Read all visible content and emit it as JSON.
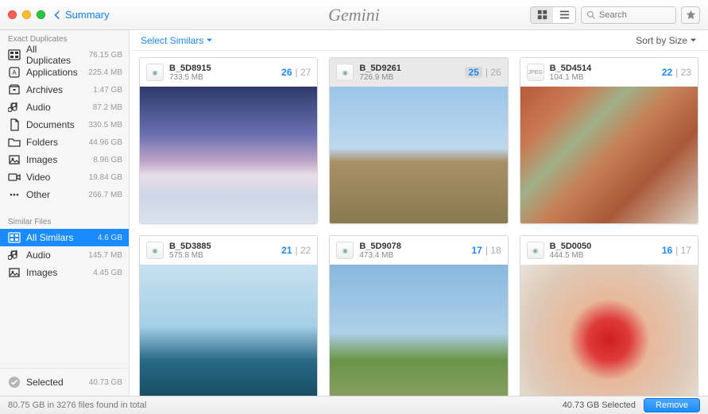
{
  "titlebar": {
    "back_label": "Summary",
    "app_name": "Gemini",
    "search_placeholder": "Search"
  },
  "sidebar": {
    "exact_header": "Exact Duplicates",
    "similar_header": "Similar Files",
    "exact": [
      {
        "icon": "all",
        "label": "All Duplicates",
        "size": "76.15 GB"
      },
      {
        "icon": "app",
        "label": "Applications",
        "size": "225.4 MB"
      },
      {
        "icon": "archive",
        "label": "Archives",
        "size": "1.47 GB"
      },
      {
        "icon": "audio",
        "label": "Audio",
        "size": "87.2 MB"
      },
      {
        "icon": "doc",
        "label": "Documents",
        "size": "330.5 MB"
      },
      {
        "icon": "folder",
        "label": "Folders",
        "size": "44.96 GB"
      },
      {
        "icon": "image",
        "label": "Images",
        "size": "8.96 GB"
      },
      {
        "icon": "video",
        "label": "Video",
        "size": "19.84 GB"
      },
      {
        "icon": "other",
        "label": "Other",
        "size": "266.7 MB"
      }
    ],
    "similar": [
      {
        "icon": "all",
        "label": "All Similars",
        "size": "4.6 GB",
        "active": true
      },
      {
        "icon": "audio",
        "label": "Audio",
        "size": "145.7 MB"
      },
      {
        "icon": "image",
        "label": "Images",
        "size": "4.45 GB"
      }
    ],
    "selected": {
      "label": "Selected",
      "size": "40.73 GB"
    }
  },
  "content_bar": {
    "select_similars": "Select Similars",
    "sort_by": "Sort by Size"
  },
  "cards": [
    {
      "name": "B_5D8915",
      "size": "733.5 MB",
      "sel": 26,
      "tot": 27,
      "type": "cr2",
      "active": false,
      "bg": "mountains"
    },
    {
      "name": "B_5D9261",
      "size": "726.9 MB",
      "sel": 25,
      "tot": 26,
      "type": "cr2",
      "active": true,
      "bg": "tree"
    },
    {
      "name": "B_5D4514",
      "size": "104.1 MB",
      "sel": 22,
      "tot": 23,
      "type": "jpg",
      "active": false,
      "bg": "city"
    },
    {
      "name": "B_5D3885",
      "size": "575.8 MB",
      "sel": 21,
      "tot": 22,
      "type": "cr2",
      "active": false,
      "bg": "burj"
    },
    {
      "name": "B_5D9078",
      "size": "473.4 MB",
      "sel": 17,
      "tot": 18,
      "type": "cr2",
      "active": false,
      "bg": "windmill"
    },
    {
      "name": "B_5D0050",
      "size": "444.5 MB",
      "sel": 16,
      "tot": 17,
      "type": "cr2",
      "active": false,
      "bg": "hands"
    }
  ],
  "bottom": {
    "total": "80.75 GB in 3276 files found in total",
    "selected": "40.73 GB Selected",
    "remove": "Remove"
  },
  "thumb_backgrounds": {
    "mountains": "linear-gradient(180deg,#2e3a6b 0%,#6a6fb0 35%,#bfa5c8 55%,#e8dfe8 65%,#cdd6e6 80%,#dbe3ef 100%)",
    "tree": "linear-gradient(180deg,#9cc5e8 0%,#bdd8ee 45%,#a89066 55%,#8a7a4e 100%)",
    "city": "linear-gradient(135deg,#b85a3a 0%,#c97a52 20%,#9fb088 35%,#c78057 50%,#a95838 70%,#d9cfc2 100%)",
    "burj": "linear-gradient(180deg,#c7e1ef 0%,#a4cfe6 45%,#2a6a87 70%,#154a5f 100%)",
    "windmill": "linear-gradient(180deg,#88b8de 0%,#aed0e8 50%,#6a9448 70%,#8aa063 100%)",
    "hands": "radial-gradient(circle at 50% 55%,#d01e1e 0%,#de3a3a 18%,#e8b89a 35%,#decab8 70%,#e8e2da 100%)"
  }
}
